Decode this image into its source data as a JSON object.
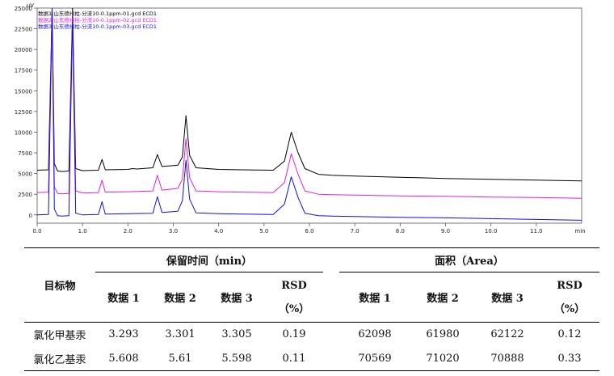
{
  "chart_data": {
    "type": "line",
    "ylabel": "uV",
    "xunit": "min",
    "xlim": [
      0.0,
      12.0
    ],
    "ylim": [
      -1000,
      25000
    ],
    "x_ticks": [
      "0.0",
      "1.0",
      "2.0",
      "3.0",
      "4.0",
      "5.0",
      "6.0",
      "7.0",
      "8.0",
      "9.0",
      "10.0",
      "11.0"
    ],
    "y_ticks": [
      "0",
      "2500",
      "5000",
      "7500",
      "10000",
      "12500",
      "15000",
      "17500",
      "20000",
      "22500",
      "25000"
    ],
    "series": [
      {
        "name": "数据1:山东德州柱-分流10-0.1ppm-01.gcd ECD1",
        "color": "#000000",
        "points": [
          [
            0.0,
            5400
          ],
          [
            0.25,
            5450
          ],
          [
            0.33,
            25000
          ],
          [
            0.38,
            6200
          ],
          [
            0.45,
            5300
          ],
          [
            0.55,
            5250
          ],
          [
            0.7,
            5300
          ],
          [
            0.78,
            25000
          ],
          [
            0.85,
            5600
          ],
          [
            1.0,
            5350
          ],
          [
            1.35,
            5400
          ],
          [
            1.43,
            6700
          ],
          [
            1.5,
            5450
          ],
          [
            2.0,
            5500
          ],
          [
            2.1,
            5600
          ],
          [
            2.2,
            5550
          ],
          [
            2.55,
            5700
          ],
          [
            2.65,
            7300
          ],
          [
            2.75,
            5850
          ],
          [
            3.1,
            6000
          ],
          [
            3.2,
            7000
          ],
          [
            3.28,
            12000
          ],
          [
            3.36,
            7200
          ],
          [
            3.5,
            5700
          ],
          [
            4.0,
            5500
          ],
          [
            4.5,
            5450
          ],
          [
            5.2,
            5400
          ],
          [
            5.45,
            6500
          ],
          [
            5.6,
            10000
          ],
          [
            5.75,
            7500
          ],
          [
            5.9,
            5600
          ],
          [
            6.2,
            4900
          ],
          [
            6.5,
            4800
          ],
          [
            7.0,
            4700
          ],
          [
            8.0,
            4550
          ],
          [
            9.0,
            4400
          ],
          [
            10.0,
            4300
          ],
          [
            11.0,
            4200
          ],
          [
            12.0,
            4100
          ]
        ]
      },
      {
        "name": "数据2:山东德州柱-分流10-0.1ppm-02.gcd ECD1",
        "color": "#e020e0",
        "points": [
          [
            0.0,
            2700
          ],
          [
            0.25,
            2750
          ],
          [
            0.33,
            25000
          ],
          [
            0.38,
            3400
          ],
          [
            0.45,
            2600
          ],
          [
            0.55,
            2550
          ],
          [
            0.7,
            2600
          ],
          [
            0.78,
            24500
          ],
          [
            0.85,
            2900
          ],
          [
            1.0,
            2650
          ],
          [
            1.35,
            2700
          ],
          [
            1.43,
            4200
          ],
          [
            1.5,
            2750
          ],
          [
            2.0,
            2800
          ],
          [
            2.55,
            2900
          ],
          [
            2.65,
            4800
          ],
          [
            2.75,
            3000
          ],
          [
            3.1,
            3200
          ],
          [
            3.2,
            4300
          ],
          [
            3.28,
            9200
          ],
          [
            3.36,
            4500
          ],
          [
            3.5,
            2900
          ],
          [
            4.0,
            2800
          ],
          [
            4.5,
            2750
          ],
          [
            5.2,
            2700
          ],
          [
            5.45,
            3900
          ],
          [
            5.6,
            7400
          ],
          [
            5.75,
            4900
          ],
          [
            5.9,
            2900
          ],
          [
            6.2,
            2500
          ],
          [
            6.5,
            2450
          ],
          [
            7.0,
            2400
          ],
          [
            8.0,
            2300
          ],
          [
            9.0,
            2250
          ],
          [
            10.0,
            2150
          ],
          [
            11.0,
            2100
          ],
          [
            12.0,
            2000
          ]
        ]
      },
      {
        "name": "数据3:山东德州柱-分流10-0.1ppm-03.gcd ECD1",
        "color": "#1010e0",
        "points": [
          [
            0.0,
            0
          ],
          [
            0.25,
            50
          ],
          [
            0.33,
            25000
          ],
          [
            0.38,
            700
          ],
          [
            0.45,
            -100
          ],
          [
            0.55,
            -150
          ],
          [
            0.7,
            -100
          ],
          [
            0.78,
            24000
          ],
          [
            0.85,
            200
          ],
          [
            1.0,
            0
          ],
          [
            1.35,
            50
          ],
          [
            1.43,
            1600
          ],
          [
            1.5,
            100
          ],
          [
            2.0,
            150
          ],
          [
            2.55,
            200
          ],
          [
            2.65,
            2200
          ],
          [
            2.75,
            300
          ],
          [
            3.1,
            450
          ],
          [
            3.2,
            1700
          ],
          [
            3.28,
            6600
          ],
          [
            3.36,
            1900
          ],
          [
            3.5,
            250
          ],
          [
            4.0,
            150
          ],
          [
            4.5,
            100
          ],
          [
            5.2,
            50
          ],
          [
            5.45,
            1300
          ],
          [
            5.6,
            4600
          ],
          [
            5.75,
            2100
          ],
          [
            5.9,
            200
          ],
          [
            6.2,
            -100
          ],
          [
            6.5,
            -150
          ],
          [
            7.0,
            -200
          ],
          [
            8.0,
            -300
          ],
          [
            9.0,
            -350
          ],
          [
            10.0,
            -450
          ],
          [
            11.0,
            -550
          ],
          [
            12.0,
            -650
          ]
        ]
      }
    ]
  },
  "table": {
    "target_header": "目标物",
    "retention_header": "保留时间（min）",
    "area_header": "面积（Area）",
    "sub_headers": [
      "数据 1",
      "数据 2",
      "数据 3"
    ],
    "rsd_label": "RSD",
    "rsd_unit": "（%）",
    "rows": [
      {
        "name": "氯化甲基汞",
        "rt": [
          "3.293",
          "3.301",
          "3.305"
        ],
        "rt_rsd": "0.19",
        "area": [
          "62098",
          "61980",
          "62122"
        ],
        "area_rsd": "0.12"
      },
      {
        "name": "氯化乙基汞",
        "rt": [
          "5.608",
          "5.61",
          "5.598"
        ],
        "rt_rsd": "0.11",
        "area": [
          "70569",
          "71020",
          "70888"
        ],
        "area_rsd": "0.33"
      }
    ]
  }
}
